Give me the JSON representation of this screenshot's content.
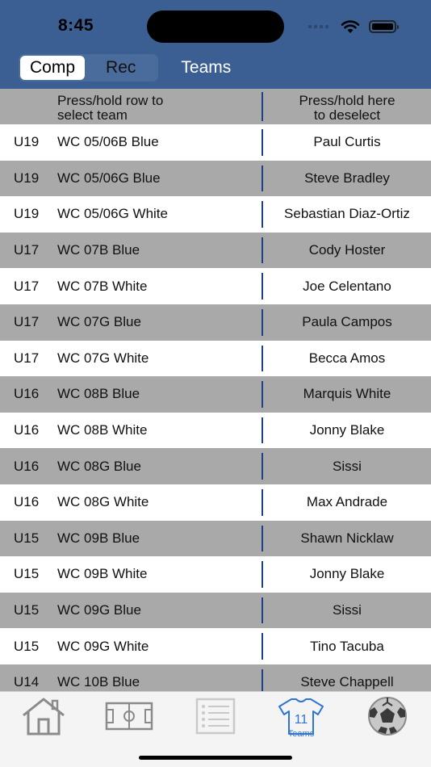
{
  "status_bar": {
    "time": "8:45"
  },
  "nav": {
    "segments": [
      {
        "label": "Comp",
        "active": true
      },
      {
        "label": "Rec",
        "active": false
      }
    ],
    "teams_label": "Teams"
  },
  "table": {
    "header_left": "Press/hold row to\nselect team",
    "header_right": "Press/hold here\nto deselect",
    "rows": [
      {
        "age": "U19",
        "team": "WC 05/06B Blue",
        "coach": "Paul Curtis"
      },
      {
        "age": "U19",
        "team": "WC 05/06G Blue",
        "coach": "Steve Bradley"
      },
      {
        "age": "U19",
        "team": "WC 05/06G White",
        "coach": "Sebastian Diaz-Ortiz"
      },
      {
        "age": "U17",
        "team": "WC 07B Blue",
        "coach": "Cody Hoster"
      },
      {
        "age": "U17",
        "team": "WC 07B White",
        "coach": "Joe Celentano"
      },
      {
        "age": "U17",
        "team": "WC 07G Blue",
        "coach": "Paula Campos"
      },
      {
        "age": "U17",
        "team": "WC 07G White",
        "coach": "Becca Amos"
      },
      {
        "age": "U16",
        "team": "WC 08B Blue",
        "coach": "Marquis White"
      },
      {
        "age": "U16",
        "team": "WC 08B White",
        "coach": "Jonny Blake"
      },
      {
        "age": "U16",
        "team": "WC 08G Blue",
        "coach": "Sissi"
      },
      {
        "age": "U16",
        "team": "WC 08G White",
        "coach": "Max Andrade"
      },
      {
        "age": "U15",
        "team": "WC 09B Blue",
        "coach": "Shawn Nicklaw"
      },
      {
        "age": "U15",
        "team": "WC 09B White",
        "coach": "Jonny Blake"
      },
      {
        "age": "U15",
        "team": "WC 09G Blue",
        "coach": "Sissi"
      },
      {
        "age": "U15",
        "team": "WC 09G White",
        "coach": "Tino Tacuba"
      },
      {
        "age": "U14",
        "team": "WC 10B Blue",
        "coach": "Steve Chappell"
      }
    ]
  },
  "tabbar": {
    "items": [
      {
        "icon": "home-icon"
      },
      {
        "icon": "soccer-field-icon"
      },
      {
        "icon": "list-icon"
      },
      {
        "icon": "jersey-icon",
        "jersey_number": "11",
        "label": "Teams",
        "active": true
      },
      {
        "icon": "soccer-ball-icon"
      }
    ]
  },
  "colors": {
    "header_bg": "#3b5f93",
    "row_gray": "#a9a9a9",
    "divider": "#1f3f86",
    "active_tab": "#2f74d0"
  }
}
